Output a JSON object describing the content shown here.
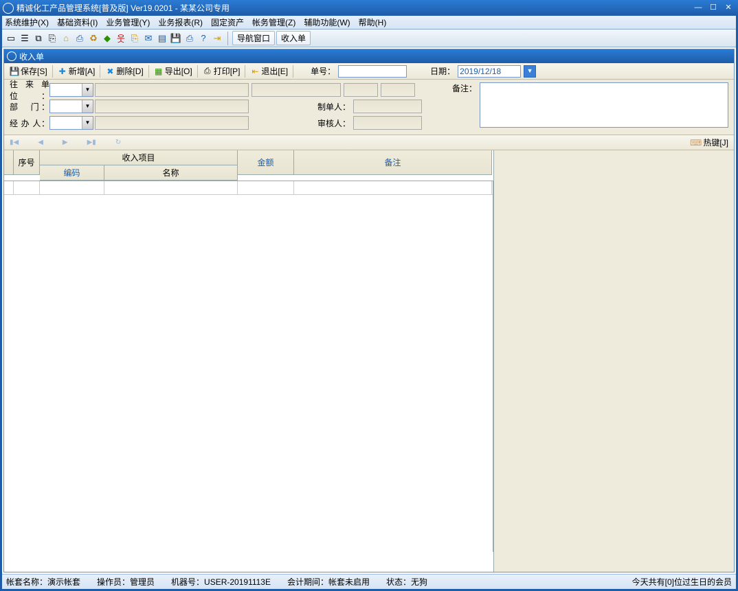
{
  "window_title": "精诚化工产品管理系统[普及版] Ver19.0201  -  某某公司专用",
  "menus": [
    "系统维护(X)",
    "基础资料(I)",
    "业务管理(Y)",
    "业务报表(R)",
    "固定资产",
    "帐务管理(Z)",
    "辅助功能(W)",
    "帮助(H)"
  ],
  "maintool_btns": {
    "nav": "导航窗口",
    "income": "收入单"
  },
  "subwindow_title": "收入单",
  "actions": {
    "save": "保存[S]",
    "add": "新增[A]",
    "del": "删除[D]",
    "export": "导出[O]",
    "print": "打印[P]",
    "exit": "退出[E]",
    "bill_no_label": "单号：",
    "date_label": "日期：",
    "date_value": "2019/12/18"
  },
  "form": {
    "unit_label": "往来单位：",
    "dept_label": "部　门：",
    "operator_label": "经 办 人：",
    "maker_label": "制单人：",
    "auditor_label": "审核人：",
    "remark_label": "备注："
  },
  "hotkey_label": "热键[J]",
  "grid": {
    "seq": "序号",
    "income_item": "收入项目",
    "code": "编码",
    "name": "名称",
    "amount": "金额",
    "remark": "备注"
  },
  "status": {
    "account": "帐套名称：演示帐套",
    "operator": "操作员：管理员",
    "machine": "机器号：USER-20191113E",
    "period": "会计期间：帐套未启用",
    "state": "状态：无狗",
    "birthday": "今天共有[0]位过生日的会员"
  }
}
